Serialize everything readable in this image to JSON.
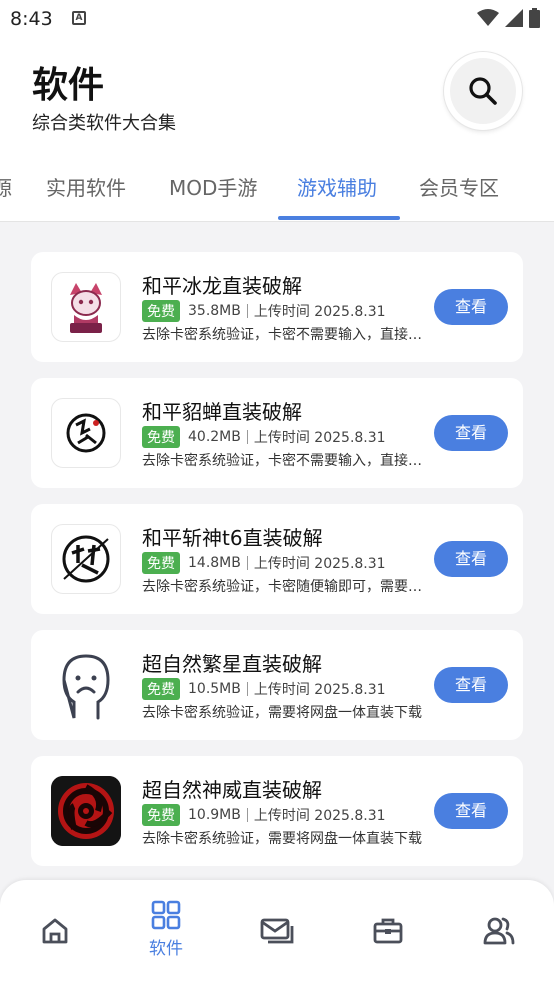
{
  "status_bar": {
    "time": "8:43"
  },
  "header": {
    "title": "软件",
    "subtitle": "综合类软件大合集"
  },
  "tabs": [
    {
      "label": "源"
    },
    {
      "label": "实用软件"
    },
    {
      "label": "MOD手游"
    },
    {
      "label": "游戏辅助",
      "active": true
    },
    {
      "label": "会员专区"
    }
  ],
  "apps": [
    {
      "name": "和平冰龙直装破解",
      "badge": "免费",
      "size": "35.8MB",
      "upload": "上传时间 2025.8.31",
      "desc": "去除卡密系统验证，卡密不需要输入，直接进入",
      "button": "查看",
      "icon": "ice-dragon-mascot-icon"
    },
    {
      "name": "和平貂蝉直装破解",
      "badge": "免费",
      "size": "40.2MB",
      "upload": "上传时间 2025.8.31",
      "desc": "去除卡密系统验证，卡密不需要输入，直接进入",
      "button": "查看",
      "icon": "diaochan-calligraphy-icon"
    },
    {
      "name": "和平斩神t6直装破解",
      "badge": "免费",
      "size": "14.8MB",
      "upload": "上传时间 2025.8.31",
      "desc": "去除卡密系统验证，卡密随便输即可，需要注意",
      "button": "查看",
      "icon": "zhanshen-calligraphy-icon"
    },
    {
      "name": "超自然繁星直装破解",
      "badge": "免费",
      "size": "10.5MB",
      "upload": "上传时间 2025.8.31",
      "desc": "去除卡密系统验证，需要将网盘一体直装下载",
      "button": "查看",
      "icon": "sad-face-icon"
    },
    {
      "name": "超自然神威直装破解",
      "badge": "免费",
      "size": "10.9MB",
      "upload": "上传时间 2025.8.31",
      "desc": "去除卡密系统验证，需要将网盘一体直装下载",
      "button": "查看",
      "icon": "sharingan-icon"
    }
  ],
  "bottom_nav": {
    "active_label": "软件",
    "items": [
      "home-icon",
      "grid-icon",
      "mail-icon",
      "briefcase-icon",
      "users-icon"
    ]
  },
  "colors": {
    "accent": "#4a7fe0",
    "badge": "#4caf50",
    "background": "#f3f3f5"
  }
}
